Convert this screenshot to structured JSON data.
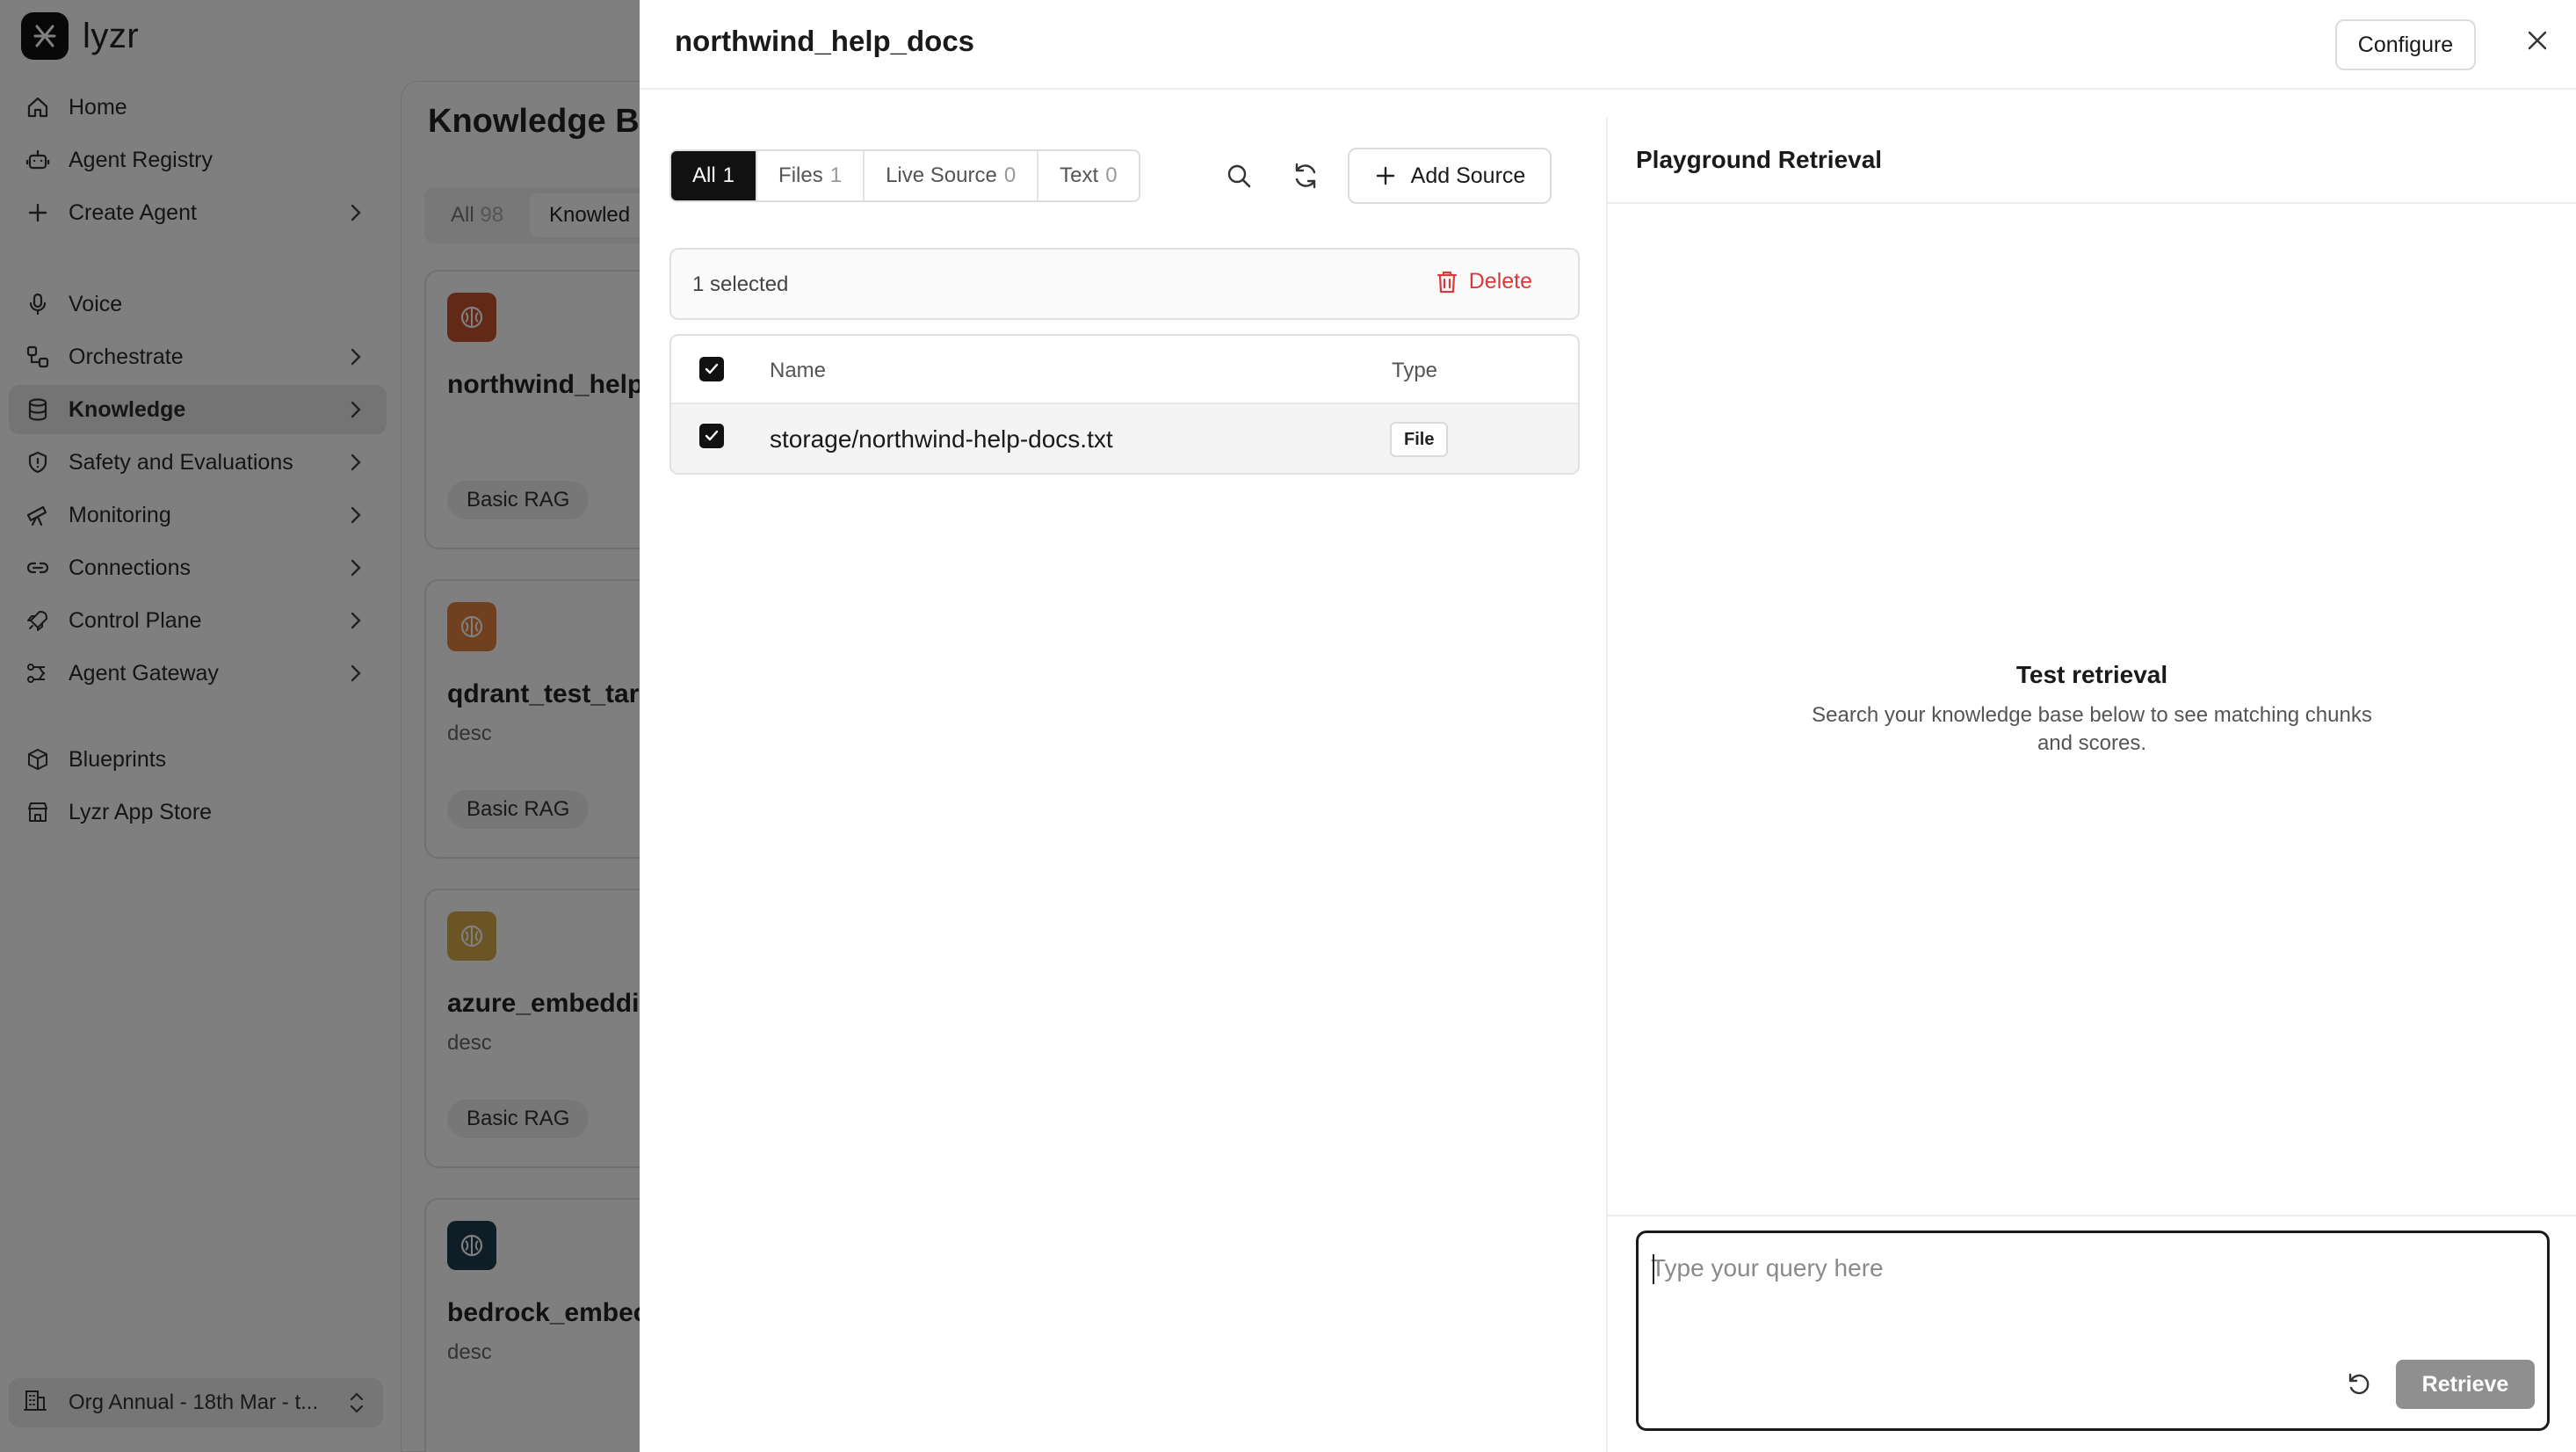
{
  "app": {
    "logo_text": "lyzr"
  },
  "sidebar": {
    "items": [
      {
        "label": "Home",
        "icon": "home-icon"
      },
      {
        "label": "Agent Registry",
        "icon": "robot-icon"
      },
      {
        "label": "Create Agent",
        "icon": "plus-icon",
        "has_chevron": true
      },
      {
        "label": "Voice",
        "icon": "microphone-icon"
      },
      {
        "label": "Orchestrate",
        "icon": "workflow-icon",
        "has_chevron": true
      },
      {
        "label": "Knowledge",
        "icon": "database-icon",
        "has_chevron": true,
        "active": true
      },
      {
        "label": "Safety and Evaluations",
        "icon": "shield-icon",
        "has_chevron": true
      },
      {
        "label": "Monitoring",
        "icon": "telescope-icon",
        "has_chevron": true
      },
      {
        "label": "Connections",
        "icon": "link-icon",
        "has_chevron": true
      },
      {
        "label": "Control Plane",
        "icon": "rocket-icon",
        "has_chevron": true
      },
      {
        "label": "Agent Gateway",
        "icon": "gateway-icon",
        "has_chevron": true
      },
      {
        "label": "Blueprints",
        "icon": "package-icon"
      },
      {
        "label": "Lyzr App Store",
        "icon": "store-icon"
      }
    ],
    "org": "Org Annual - 18th Mar - t..."
  },
  "knowledge_base": {
    "title": "Knowledge Ba",
    "tabs": [
      {
        "label": "All",
        "count": "98"
      },
      {
        "label": "Knowled"
      }
    ],
    "cards": [
      {
        "name": "northwind_help_",
        "desc": "",
        "badge": "Basic RAG",
        "icon_color": "#c5532e"
      },
      {
        "name": "qdrant_test_tar",
        "desc": "desc",
        "badge": "Basic RAG",
        "icon_color": "#e0803e"
      },
      {
        "name": "azure_embeddir",
        "desc": "desc",
        "badge": "Basic RAG",
        "icon_color": "#d8aa4a"
      },
      {
        "name": "bedrock_embec",
        "desc": "desc",
        "badge": "",
        "icon_color": "#1f3b4d"
      }
    ]
  },
  "drawer": {
    "title": "northwind_help_docs",
    "configure_label": "Configure",
    "filters": [
      {
        "label": "All",
        "count": "1",
        "active": true
      },
      {
        "label": "Files",
        "count": "1"
      },
      {
        "label": "Live Source",
        "count": "0"
      },
      {
        "label": "Text",
        "count": "0"
      }
    ],
    "add_source_label": "Add Source",
    "selection": {
      "text": "1 selected",
      "delete_label": "Delete"
    },
    "table": {
      "headers": {
        "name": "Name",
        "type": "Type"
      },
      "rows": [
        {
          "name": "storage/northwind-help-docs.txt",
          "type": "File",
          "checked": true
        }
      ]
    },
    "playground": {
      "title": "Playground Retrieval",
      "empty_title": "Test retrieval",
      "empty_subtitle": "Search your knowledge base below to see matching chunks and scores.",
      "query_placeholder": "Type your query here",
      "retrieve_label": "Retrieve"
    }
  },
  "colors": {
    "accent": "#111111",
    "danger": "#d63a3a",
    "disabled_button": "#8f8f8f"
  }
}
